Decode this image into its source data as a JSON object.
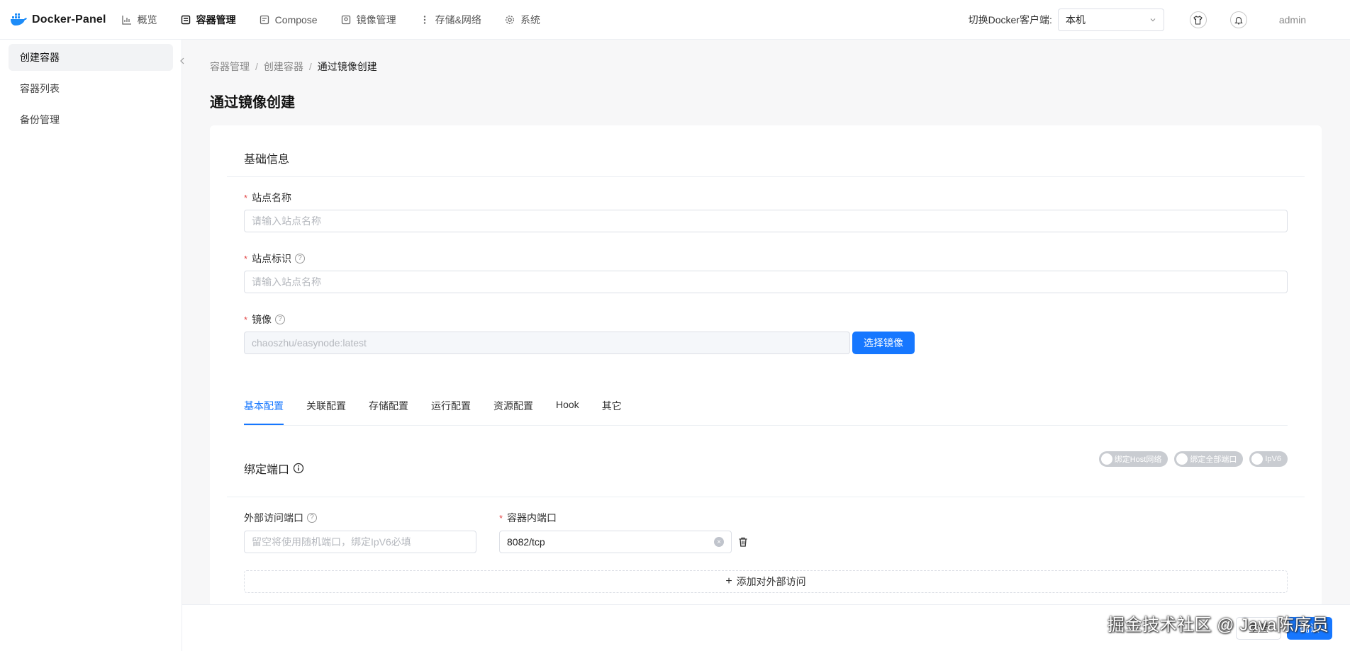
{
  "app": {
    "name": "Docker-Panel"
  },
  "nav": {
    "items": [
      {
        "label": "概览",
        "icon": "chart-icon"
      },
      {
        "label": "容器管理",
        "icon": "container-icon",
        "active": true
      },
      {
        "label": "Compose",
        "icon": "compose-icon"
      },
      {
        "label": "镜像管理",
        "icon": "image-icon"
      },
      {
        "label": "存储&网络",
        "icon": "dots-icon"
      },
      {
        "label": "系统",
        "icon": "gear-icon"
      }
    ]
  },
  "header": {
    "switch_label": "切换Docker客户端:",
    "client_value": "本机",
    "user": "admin"
  },
  "sidebar": {
    "items": [
      {
        "label": "创建容器",
        "active": true
      },
      {
        "label": "容器列表"
      },
      {
        "label": "备份管理"
      }
    ]
  },
  "breadcrumb": {
    "items": [
      "容器管理",
      "创建容器",
      "通过镜像创建"
    ]
  },
  "page": {
    "title": "通过镜像创建"
  },
  "basic": {
    "section_title": "基础信息",
    "site_name": {
      "label": "站点名称",
      "placeholder": "请输入站点名称"
    },
    "site_id": {
      "label": "站点标识",
      "placeholder": "请输入站点名称"
    },
    "image": {
      "label": "镜像",
      "value": "chaoszhu/easynode:latest",
      "button": "选择镜像"
    }
  },
  "tabs": {
    "items": [
      "基本配置",
      "关联配置",
      "存储配置",
      "运行配置",
      "资源配置",
      "Hook",
      "其它"
    ],
    "active_index": 0
  },
  "ports": {
    "section_title": "绑定端口",
    "toggles": [
      "绑定Host网络",
      "绑定全部端口",
      "IpV6"
    ],
    "external_label": "外部访问端口",
    "external_placeholder": "留空将使用随机端口，绑定IpV6必填",
    "internal_label": "容器内端口",
    "internal_value": "8082/tcp",
    "add_label": "添加对外部访问"
  },
  "footer": {
    "reset_label": "重置",
    "confirm_label": "确认"
  },
  "watermark": "掘金技术社区 @ Java陈序员",
  "colors": {
    "primary": "#1677ff",
    "required": "#e34d4d"
  }
}
